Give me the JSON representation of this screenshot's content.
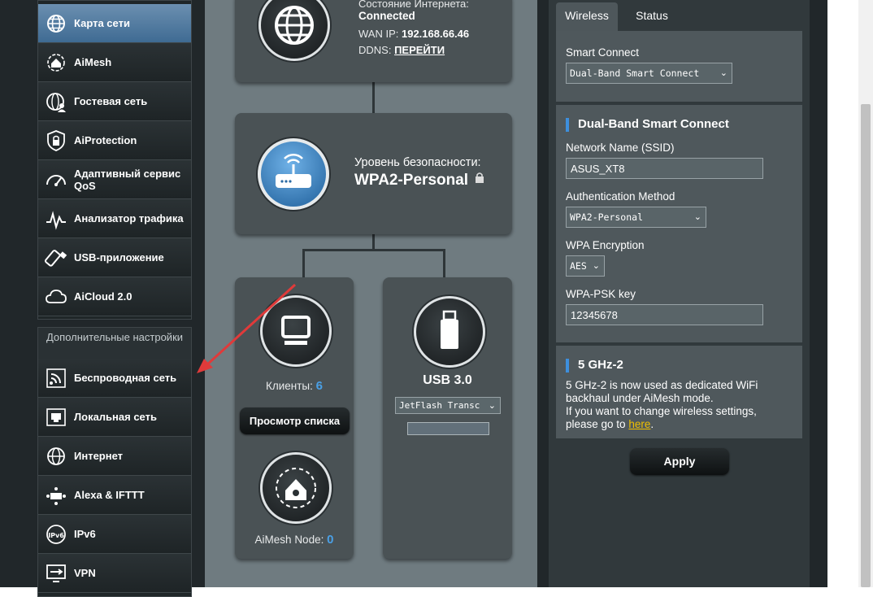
{
  "sidebar": {
    "main_items": [
      {
        "label": "Карта сети",
        "icon": "network-map-icon"
      },
      {
        "label": "AiMesh",
        "icon": "aimesh-icon"
      },
      {
        "label": "Гостевая сеть",
        "icon": "guest-network-icon"
      },
      {
        "label": "AiProtection",
        "icon": "shield-lock-icon"
      },
      {
        "label": "Адаптивный сервис QoS",
        "icon": "speedometer-icon"
      },
      {
        "label": "Анализатор трафика",
        "icon": "traffic-analyzer-icon"
      },
      {
        "label": "USB-приложение",
        "icon": "usb-icon"
      },
      {
        "label": "AiCloud 2.0",
        "icon": "cloud-icon"
      }
    ],
    "advanced_header": "Дополнительные настройки",
    "advanced_items": [
      {
        "label": "Беспроводная сеть",
        "icon": "wireless-icon"
      },
      {
        "label": "Локальная сеть",
        "icon": "lan-icon"
      },
      {
        "label": "Интернет",
        "icon": "globe-icon"
      },
      {
        "label": "Alexa & IFTTT",
        "icon": "alexa-ifttt-icon"
      },
      {
        "label": "IPv6",
        "icon": "ipv6-icon"
      },
      {
        "label": "VPN",
        "icon": "vpn-icon"
      }
    ]
  },
  "internet": {
    "status_label": "Состояние Интернета:",
    "status_value": "Connected",
    "wan_ip_label": "WAN IP:",
    "wan_ip_value": "192.168.66.46",
    "ddns_label": "DDNS:",
    "ddns_link": "ПЕРЕЙТИ"
  },
  "router": {
    "security_label": "Уровень безопасности:",
    "security_value": "WPA2-Personal"
  },
  "clients": {
    "label": "Клиенты:",
    "count": "6",
    "view_list_button": "Просмотр списка"
  },
  "aimesh": {
    "label": "AiMesh Node:",
    "count": "0"
  },
  "usb": {
    "title": "USB 3.0",
    "device_select": "JetFlash Transc"
  },
  "panel": {
    "tabs": [
      "Wireless",
      "Status"
    ],
    "smart_connect_label": "Smart Connect",
    "smart_connect_value": "Dual-Band Smart Connect",
    "section1_title": "Dual-Band Smart Connect",
    "ssid_label": "Network Name (SSID)",
    "ssid_value": "ASUS_XT8",
    "auth_label": "Authentication Method",
    "auth_value": "WPA2-Personal",
    "enc_label": "WPA Encryption",
    "enc_value": "AES",
    "psk_label": "WPA-PSK key",
    "psk_value": "12345678",
    "section2_title": "5 GHz-2",
    "section2_text_1": "5 GHz-2 is now used as dedicated WiFi",
    "section2_text_2": "backhaul under AiMesh mode.",
    "section2_text_3": "If you want to change wireless settings,",
    "section2_text_4": "please go to",
    "section2_link": "here",
    "section2_text_end": ".",
    "apply_button": "Apply"
  },
  "colors": {
    "accent_blue": "#3d8fdd",
    "link_gold": "#f0c000",
    "annotation_arrow": "#e03a3a"
  }
}
